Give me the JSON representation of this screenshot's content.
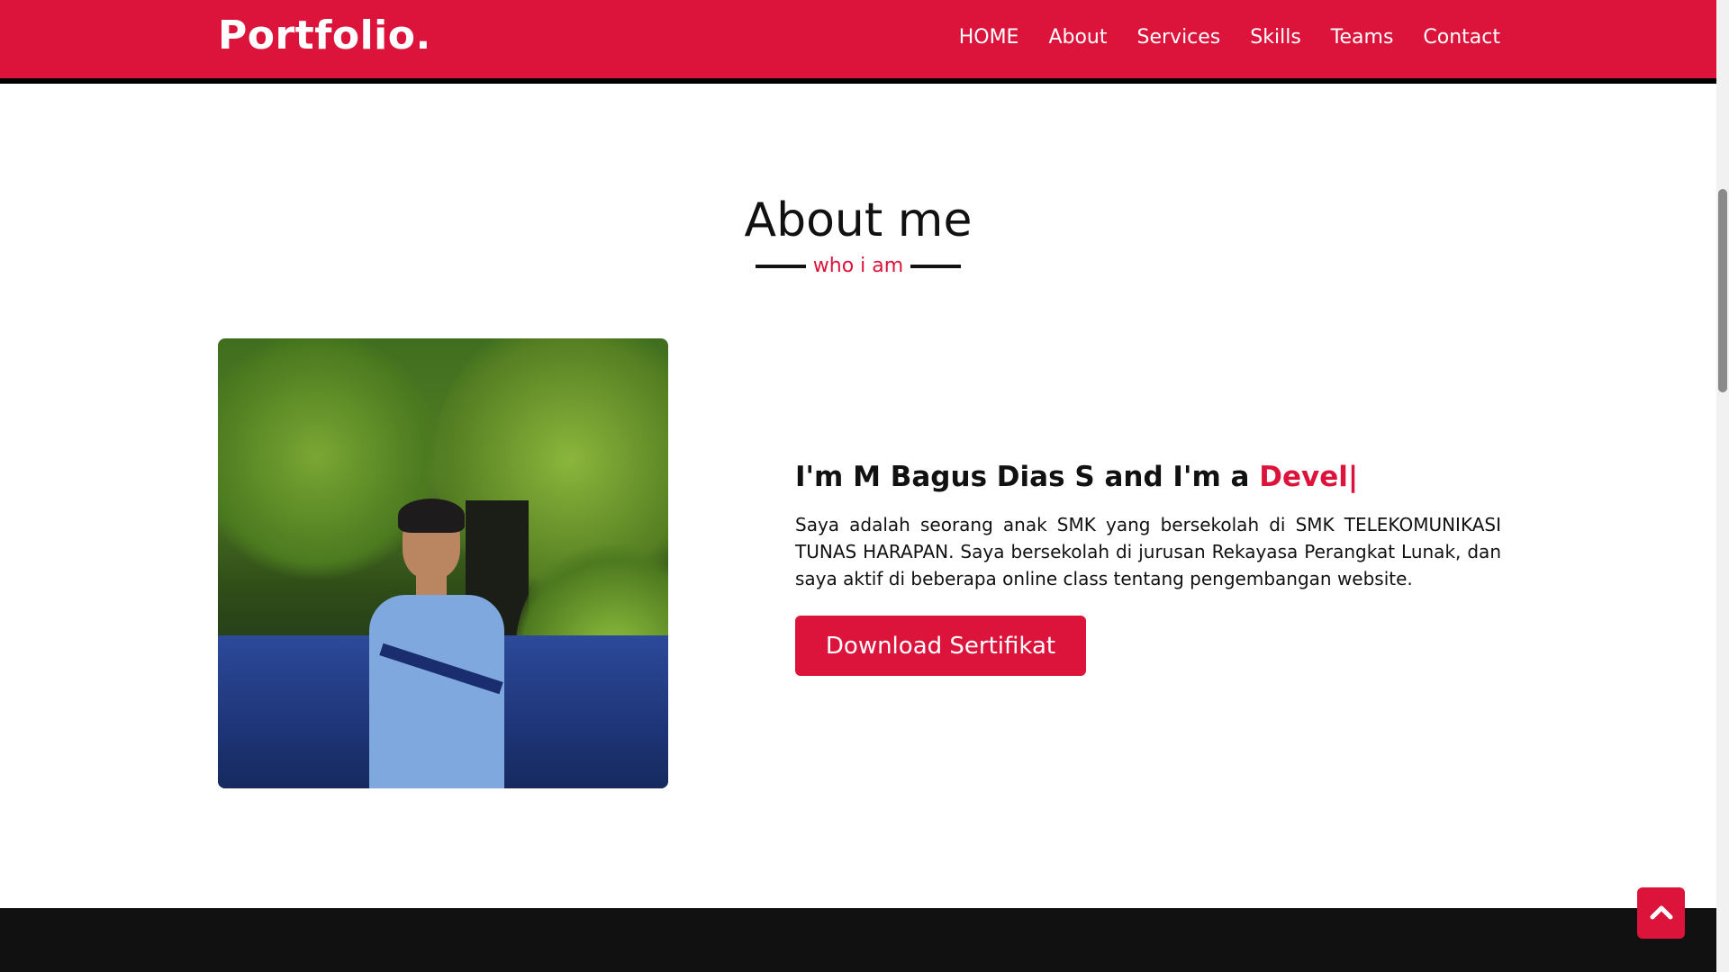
{
  "nav": {
    "logo": "Portfolio.",
    "items": [
      {
        "label": "HOME"
      },
      {
        "label": "About"
      },
      {
        "label": "Services"
      },
      {
        "label": "Skills"
      },
      {
        "label": "Teams"
      },
      {
        "label": "Contact"
      }
    ]
  },
  "about": {
    "title": "About me",
    "subtitle": "who i am",
    "intro_prefix": "I'm M Bagus Dias S and I'm a ",
    "intro_typed": "Devel|",
    "description": "Saya adalah seorang anak SMK yang bersekolah di SMK TELEKOMUNIKASI TUNAS HARAPAN. Saya bersekolah di jurusan Rekayasa Perangkat Lunak, dan saya aktif di beberapa online class tentang pengembangan website.",
    "button_label": "Download Sertifikat",
    "photo_icon": "profile-photo"
  },
  "scroll_top_icon": "chevron-up-icon",
  "colors": {
    "accent": "#dc143c",
    "dark": "#111111",
    "white": "#ffffff"
  }
}
